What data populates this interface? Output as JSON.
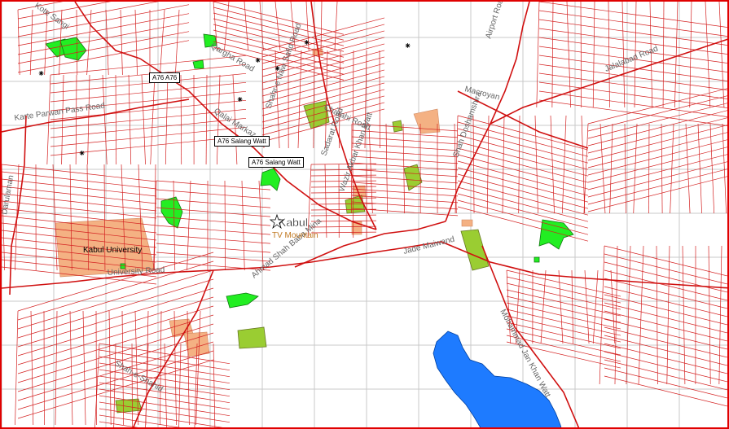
{
  "map": {
    "colors": {
      "roads": "#c81818",
      "parks": "#22ee22",
      "fields": "#9acd32",
      "buildings": "#f4b183",
      "water": "#1e7bff",
      "grid": "#c8c8c8",
      "frame": "#e00000"
    },
    "labels": {
      "city": "Kabul",
      "tv_mountain": "TV Mountain",
      "university": "Kabul University",
      "university_road": "University Road",
      "karte_parwan": "Karte Parwan Pass Road",
      "qargha": "Qargha Road",
      "qalai_markaz": "Qalai Markaz",
      "shahr_naw": "Shahr-e Naw Safid Road",
      "charahi": "Charahi Road",
      "sadarat": "Sadarat Road",
      "nadir_khan": "Wazir Akbar Khan Watt",
      "airport": "Airport Road",
      "jalalabad": "Jalalabad Road",
      "macroyan": "Macroyan",
      "sher_darwaza": "Shah Doshamshira",
      "maiwand": "Jade Maiwand",
      "mohammad_jan": "Mohammad Jan Khan Watt",
      "shahrara": "Shah-e-Shahid",
      "darulaman": "Darulaman",
      "kote_sangi": "Kote Sangi",
      "parkvah": "Ahmad Shah Baba Mina"
    },
    "shields": {
      "a76_top": "A76 A76",
      "salang_1": "A76 Salang Watt",
      "salang_2": "A76 Salang Watt"
    },
    "icons": [
      "poi-icon",
      "capital-star-icon"
    ]
  }
}
